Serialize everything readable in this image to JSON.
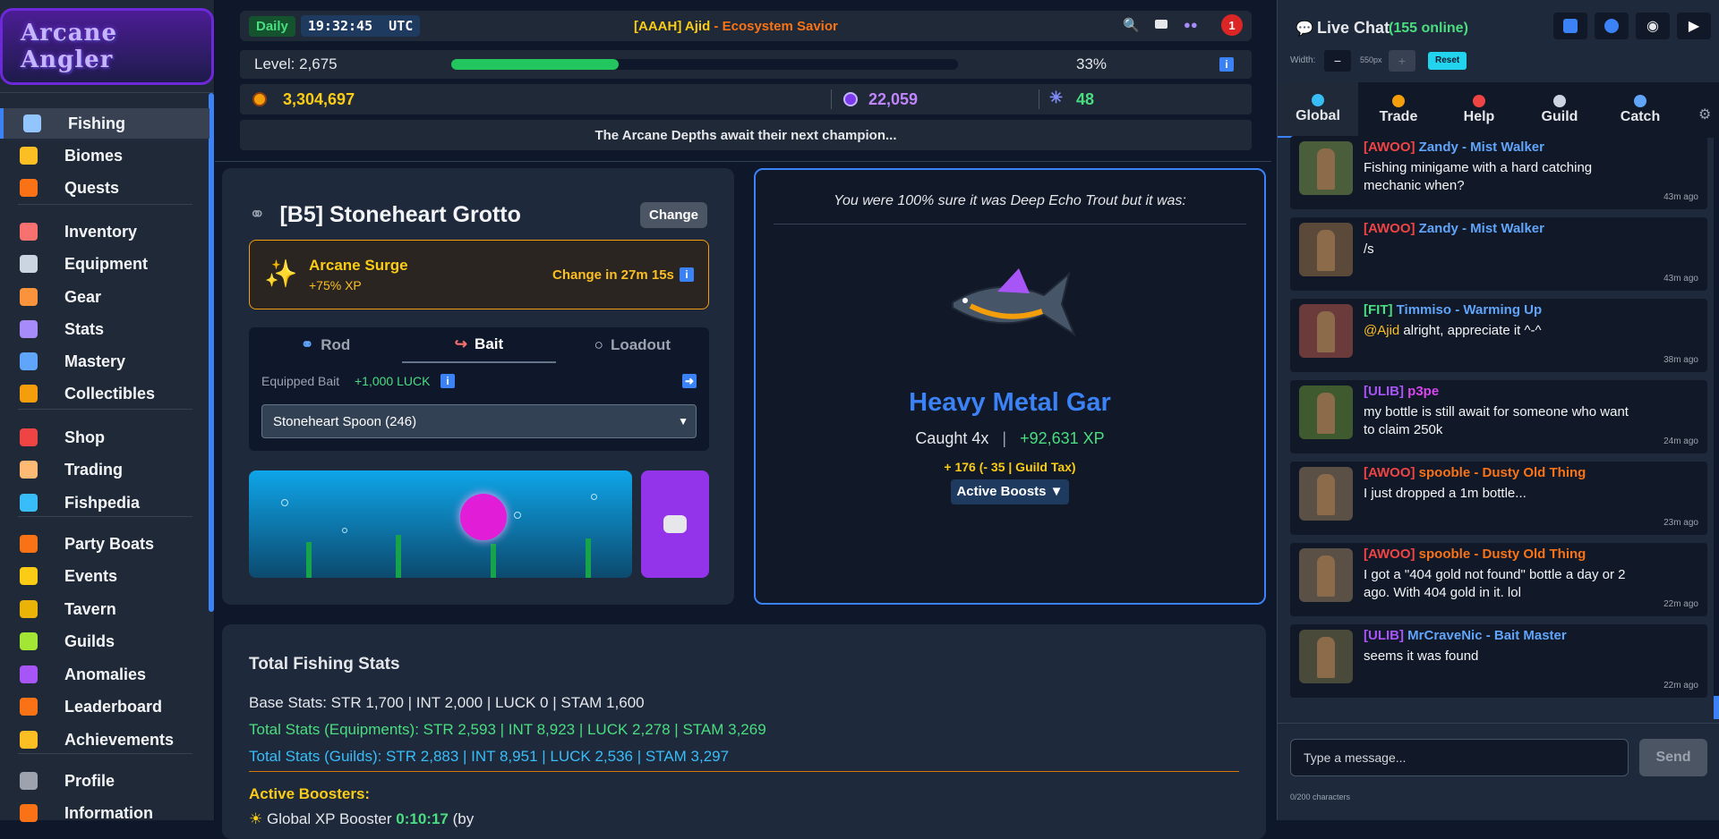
{
  "logo": {
    "text": "Arcane Angler"
  },
  "sidebar": {
    "items": [
      {
        "label": "Fishing",
        "icon": "fishing-rod-icon",
        "color": "#93c5fd"
      },
      {
        "label": "Biomes",
        "icon": "map-icon",
        "color": "#fbbf24"
      },
      {
        "label": "Quests",
        "icon": "scroll-icon",
        "color": "#f97316"
      },
      {
        "label": "Inventory",
        "icon": "bag-icon",
        "color": "#f87171"
      },
      {
        "label": "Equipment",
        "icon": "crossed-swords-icon",
        "color": "#cbd5e1"
      },
      {
        "label": "Gear",
        "icon": "gear-chest-icon",
        "color": "#fb923c"
      },
      {
        "label": "Stats",
        "icon": "sparkle-icon",
        "color": "#a78bfa"
      },
      {
        "label": "Mastery",
        "icon": "mastery-icon",
        "color": "#60a5fa"
      },
      {
        "label": "Collectibles",
        "icon": "collectible-icon",
        "color": "#f59e0b"
      },
      {
        "label": "Shop",
        "icon": "shop-icon",
        "color": "#ef4444"
      },
      {
        "label": "Trading",
        "icon": "trading-icon",
        "color": "#fdba74"
      },
      {
        "label": "Fishpedia",
        "icon": "fish-book-icon",
        "color": "#38bdf8"
      },
      {
        "label": "Party Boats",
        "icon": "boat-icon",
        "color": "#f97316"
      },
      {
        "label": "Events",
        "icon": "star-icon",
        "color": "#facc15"
      },
      {
        "label": "Tavern",
        "icon": "mug-icon",
        "color": "#eab308"
      },
      {
        "label": "Guilds",
        "icon": "guild-icon",
        "color": "#a3e635"
      },
      {
        "label": "Anomalies",
        "icon": "anomaly-icon",
        "color": "#a855f7"
      },
      {
        "label": "Leaderboard",
        "icon": "trophy-icon",
        "color": "#f97316"
      },
      {
        "label": "Achievements",
        "icon": "medal-icon",
        "color": "#fbbf24"
      },
      {
        "label": "Profile",
        "icon": "user-icon",
        "color": "#9ca3af"
      },
      {
        "label": "Information",
        "icon": "info-book-icon",
        "color": "#f97316"
      }
    ]
  },
  "topbar": {
    "daily": "Daily",
    "time": "19:32:45",
    "tz": "UTC",
    "player_tag": "[AAAH] Ajid",
    "player_sep": " - ",
    "player_title": "Ecosystem Savior",
    "notification_count": "1"
  },
  "level": {
    "label": "Level: 2,675",
    "progress_fraction": 0.33,
    "percent": "33%"
  },
  "currency": {
    "gold": "3,304,697",
    "gems": "22,059",
    "shards": "48"
  },
  "banner": "The Arcane Depths await their next champion...",
  "location": {
    "title": "[B5] Stoneheart Grotto",
    "change": "Change"
  },
  "surge": {
    "title": "Arcane Surge",
    "bonus": "+75% XP",
    "timer": "Change in 27m 15s"
  },
  "tabs": [
    {
      "label": "Rod"
    },
    {
      "label": "Bait"
    },
    {
      "label": "Loadout"
    }
  ],
  "bait": {
    "label": "Equipped Bait",
    "luck": "+1,000 LUCK",
    "selected": "Stoneheart Spoon (246)"
  },
  "catch": {
    "quote": "You were 100% sure it was Deep Echo Trout but it was:",
    "fish": "Heavy Metal Gar",
    "caught": "Caught 4x",
    "sep": "|",
    "xp": "+92,631 XP",
    "gold": "+ 176 (- 35 | Guild Tax)",
    "boosts": "Active Boosts ▼"
  },
  "stats": {
    "title": "Total Fishing Stats",
    "base": "Base Stats: STR 1,700 | INT 2,000 | LUCK 0 | STAM 1,600",
    "equip": "Total Stats (Equipments): STR 2,593 | INT 8,923 | LUCK 2,278 | STAM 3,269",
    "guilds": "Total Stats (Guilds): STR 2,883 | INT 8,951 | LUCK 2,536 | STAM 3,297",
    "boosters_title": "Active Boosters:",
    "booster_line_label": "Global XP Booster",
    "booster_line_time": "0:10:17",
    "booster_line_by": "(by"
  },
  "chat": {
    "title": "Live Chat",
    "online": "(155 online)",
    "width_label": "Width:",
    "width_value": "550px",
    "reset": "Reset",
    "tabs": [
      {
        "label": "Global",
        "icon": "globe-icon"
      },
      {
        "label": "Trade",
        "icon": "coin-icon"
      },
      {
        "label": "Help",
        "icon": "question-icon"
      },
      {
        "label": "Guild",
        "icon": "swords-icon"
      },
      {
        "label": "Catch",
        "icon": "rod-icon"
      }
    ],
    "messages": [
      {
        "guild": "[AWOO]",
        "name": "Zandy - Mist Walker",
        "guild_color": "#ef4444",
        "name_color": "#60a5fa",
        "text": "Fishing minigame with a hard catching mechanic when?",
        "time": "43m ago"
      },
      {
        "guild": "[AWOO]",
        "name": "Zandy - Mist Walker",
        "guild_color": "#ef4444",
        "name_color": "#60a5fa",
        "text": "/s",
        "time": "43m ago"
      },
      {
        "guild": "[FIT]",
        "name": "Timmiso - Warming Up",
        "guild_color": "#4ade80",
        "name_color": "#60a5fa",
        "mention": "@Ajid",
        "text": " alright, appreciate it ^-^",
        "time": "38m ago"
      },
      {
        "guild": "[ULIB]",
        "name": "p3pe",
        "guild_color": "#a855f7",
        "name_color": "#d946ef",
        "text": "my bottle is still await for someone who want to claim 250k",
        "time": "24m ago"
      },
      {
        "guild": "[AWOO]",
        "name": "spooble - Dusty Old Thing",
        "guild_color": "#ef4444",
        "name_color": "#f97316",
        "text": "I just dropped a 1m bottle...",
        "time": "23m ago"
      },
      {
        "guild": "[AWOO]",
        "name": "spooble - Dusty Old Thing",
        "guild_color": "#ef4444",
        "name_color": "#f97316",
        "text": "I got a \"404 gold not found\" bottle a day or 2 ago. With 404 gold in it. lol",
        "time": "22m ago"
      },
      {
        "guild": "[ULIB]",
        "name": "MrCraveNic - Bait Master",
        "guild_color": "#a855f7",
        "name_color": "#60a5fa",
        "text": "seems it was found",
        "time": "22m ago"
      }
    ],
    "input_placeholder": "Type a message...",
    "send": "Send",
    "char_count": "0/200 characters"
  }
}
